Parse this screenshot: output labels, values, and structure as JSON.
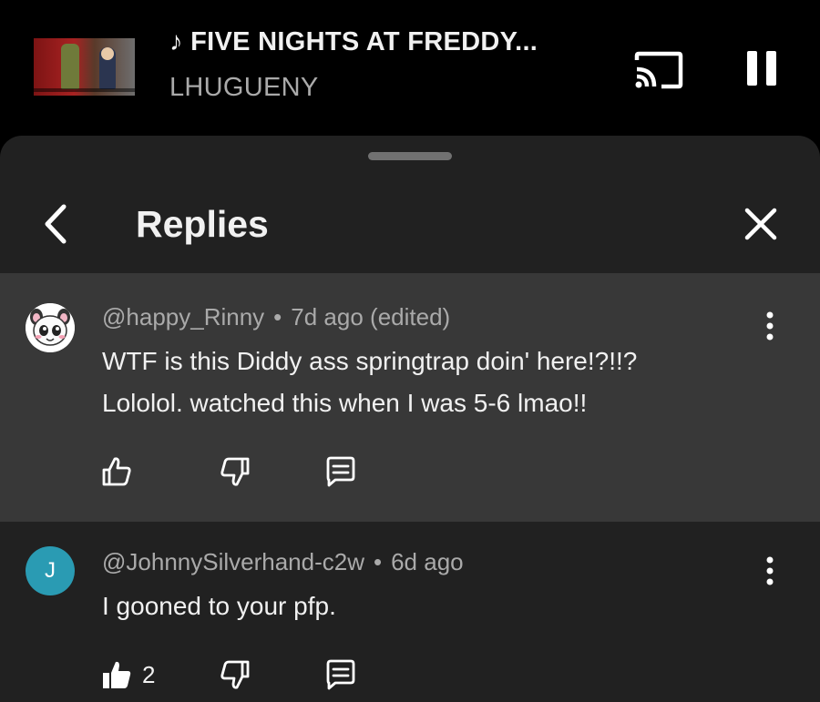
{
  "mini_player": {
    "title": "♪ FIVE NIGHTS AT FREDDY...",
    "channel": "LHUGUENY"
  },
  "sheet": {
    "title": "Replies"
  },
  "comments": [
    {
      "handle": "@happy_Rinny",
      "time": "7d ago",
      "edited": "(edited)",
      "lines": [
        "WTF is this Diddy ass springtrap doin' here!?!!?",
        "Lololol. watched this when I was 5-6 lmao!!"
      ],
      "like_count": ""
    },
    {
      "avatar_letter": "J",
      "handle": "@JohnnySilverhand-c2w",
      "time": "6d ago",
      "lines": [
        "I gooned to your pfp."
      ],
      "like_count": "2"
    }
  ],
  "colors": {
    "background": "#000000",
    "sheet": "#212121",
    "highlighted_comment": "#383838",
    "secondary_text": "#aaaaaa",
    "avatar_j": "#2a9bb3"
  },
  "icons": {
    "cast": "cast-icon",
    "pause": "pause-icon",
    "back": "chevron-left-icon",
    "close": "close-icon",
    "more": "more-vert-icon",
    "like": "thumb-up-icon",
    "dislike": "thumb-down-icon",
    "reply": "reply-comment-icon"
  }
}
